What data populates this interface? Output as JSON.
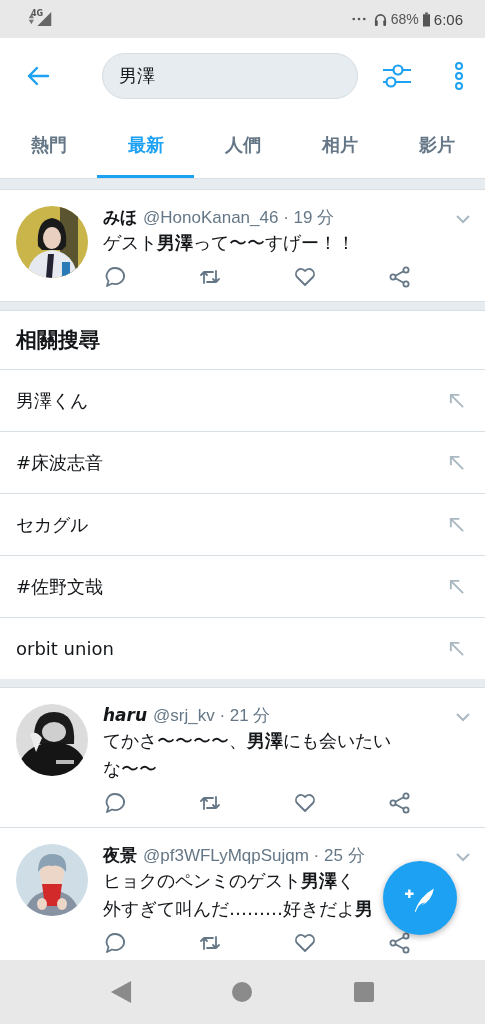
{
  "status_bar": {
    "network": "4G",
    "battery": "68%",
    "time": "6:06"
  },
  "search": {
    "value": "男澤"
  },
  "tabs": [
    {
      "label": "熱門",
      "selected": false
    },
    {
      "label": "最新",
      "selected": true
    },
    {
      "label": "人們",
      "selected": false
    },
    {
      "label": "相片",
      "selected": false
    },
    {
      "label": "影片",
      "selected": false
    }
  ],
  "tweets_top": [
    {
      "name": "みほ",
      "italic": false,
      "handle": "@HonoKanan_46 · 19 分",
      "lines": [
        "ゲスト**男澤**って〜〜すげー！！"
      ]
    }
  ],
  "related_searches": {
    "title": "相關搜尋",
    "items": [
      {
        "text": "男澤くん"
      },
      {
        "text": "#床波志音"
      },
      {
        "text": "セカグル"
      },
      {
        "text": "#佐野文哉"
      },
      {
        "text": "orbit union"
      }
    ]
  },
  "tweets_bottom": [
    {
      "name": "haru",
      "italic": true,
      "handle": "@srj_kv · 21 分",
      "lines": [
        "てかさ〜〜〜〜、**男澤**にも会いたい",
        "な〜〜"
      ]
    },
    {
      "name": "夜景",
      "italic": false,
      "handle": "@pf3WFLyMqpSujqm · 25 分",
      "lines": [
        "ヒョクのペンミのゲスト**男澤**く",
        "外すぎて叫んだ………好きだよ**男**"
      ]
    }
  ]
}
